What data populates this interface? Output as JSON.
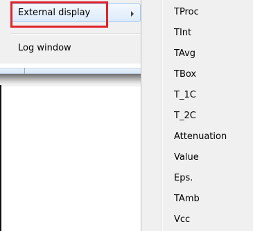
{
  "menu": {
    "items": [
      {
        "label": "External display",
        "has_submenu": true,
        "highlighted": true,
        "outlined": true
      },
      {
        "label": "Log window",
        "has_submenu": false
      }
    ]
  },
  "submenu": {
    "items": [
      {
        "label": "TProc"
      },
      {
        "label": "TInt"
      },
      {
        "label": "TAvg"
      },
      {
        "label": "TBox"
      },
      {
        "label": "T_1C"
      },
      {
        "label": "T_2C"
      },
      {
        "label": "Attenuation"
      },
      {
        "label": "Value"
      },
      {
        "label": "Eps."
      },
      {
        "label": "TAmb"
      },
      {
        "label": "Vcc"
      }
    ]
  },
  "colors": {
    "menu_background": "#f0f0f0",
    "highlight_border": "#a8c9f2",
    "annotation_box": "#e0232a"
  },
  "icons": {
    "submenu_arrow": "chevron-right-icon"
  }
}
